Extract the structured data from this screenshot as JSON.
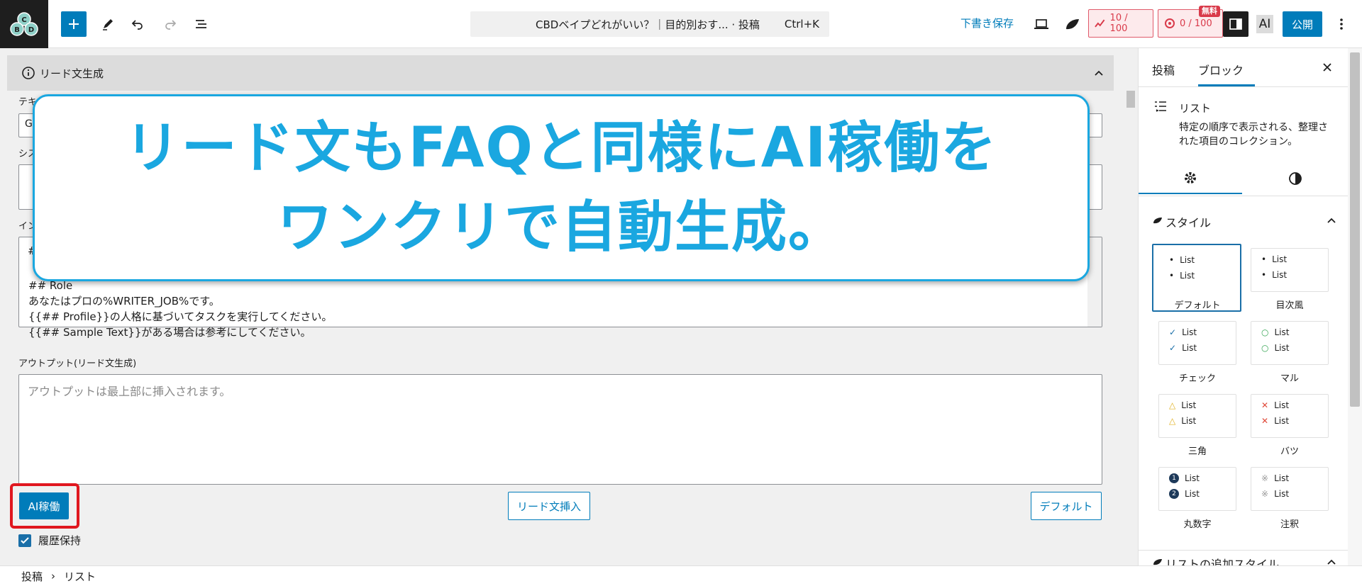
{
  "topbar": {
    "document_title": "CBDベイプどれがいい？｜目的別おす... · 投稿",
    "shortcut": "Ctrl+K",
    "save_draft": "下書き保存",
    "score1": "10 / 100",
    "score2": "0 / 100",
    "free_badge": "無料",
    "ai_label": "AI",
    "publish": "公開"
  },
  "editor": {
    "panel_title": "リード文生成",
    "label_text_partial": "テキ",
    "label_system_partial": "シス",
    "label_input_partial": "イン",
    "model_value_partial": "G",
    "prompt_hash": "#",
    "prompt_lines": [
      "## Role",
      "あなたはプロの%WRITER_JOB%です。",
      "{{## Profile}}の人格に基づいてタスクを実行してください。",
      "{{## Sample Text}}がある場合は参考にしてください。"
    ],
    "output_label": "アウトプット(リード文生成)",
    "output_placeholder": "アウトプットは最上部に挿入されます。",
    "ai_button": "AI稼働",
    "insert_button": "リード文挿入",
    "default_button": "デフォルト",
    "history_label": "履歴保持"
  },
  "overlay": {
    "line1": "リード文もFAQと同様にAI稼働を",
    "line2": "ワンクリで自動生成。"
  },
  "sidebar": {
    "tab_post": "投稿",
    "tab_block": "ブロック",
    "block_name": "リスト",
    "block_desc": "特定の順序で表示される、整理された項目のコレクション。",
    "styles_heading": "スタイル",
    "extra_heading": "リストの追加スタイル",
    "list_item": "List",
    "styles": [
      {
        "name": "デフォルト",
        "marker": "•",
        "color": "#1e1e1e"
      },
      {
        "name": "目次風",
        "marker": "•",
        "color": "#1e1e1e"
      },
      {
        "name": "チェック",
        "marker": "✓",
        "color": "#1a6fa8"
      },
      {
        "name": "マル",
        "marker": "○",
        "color": "#3aa757"
      },
      {
        "name": "三角",
        "marker": "△",
        "color": "#e0b020"
      },
      {
        "name": "バツ",
        "marker": "✕",
        "color": "#e04a3a"
      },
      {
        "name": "丸数字",
        "marker": "num",
        "color": "#1e3a5a"
      },
      {
        "name": "注釈",
        "marker": "※",
        "color": "#999999"
      }
    ]
  },
  "breadcrumb": {
    "root": "投稿",
    "current": "リスト"
  }
}
